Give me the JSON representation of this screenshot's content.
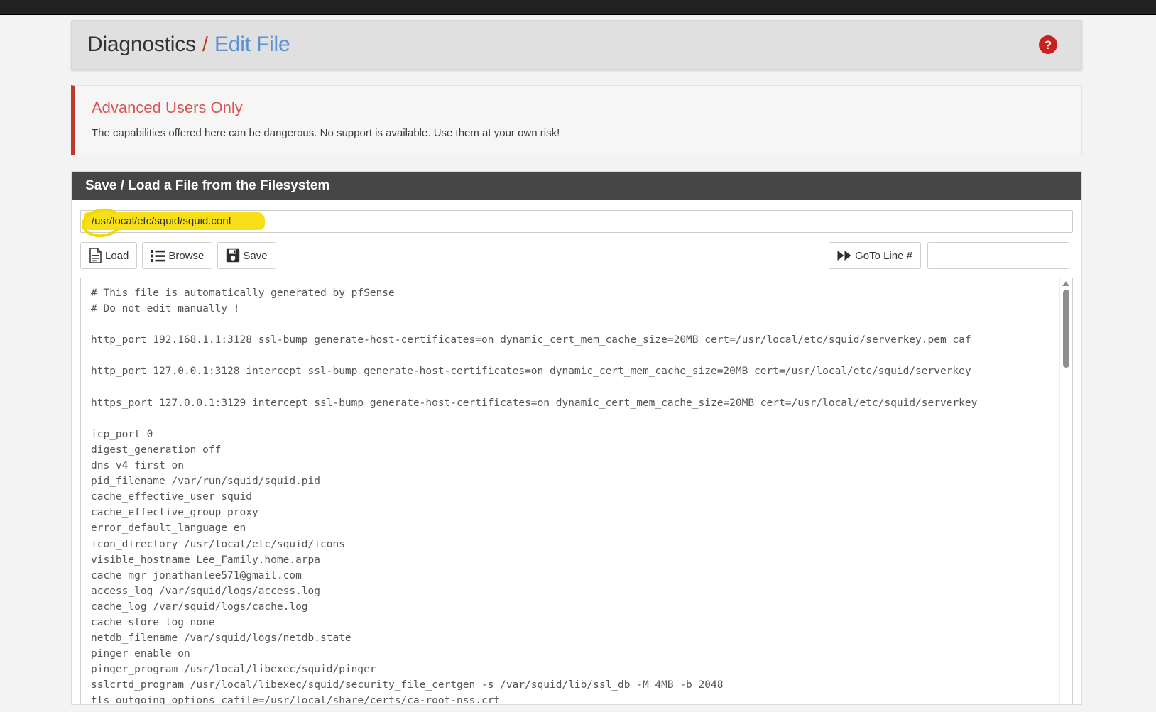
{
  "header": {
    "breadcrumb_parent": "Diagnostics",
    "breadcrumb_separator": "/",
    "breadcrumb_current": "Edit File",
    "help_icon_label": "?"
  },
  "callout": {
    "title": "Advanced Users Only",
    "body": "The capabilities offered here can be dangerous. No support is available. Use them at your own risk!"
  },
  "panel": {
    "heading": "Save / Load a File from the Filesystem"
  },
  "path_field": {
    "value": "/usr/local/etc/squid/squid.conf",
    "placeholder": ""
  },
  "toolbar": {
    "load_label": "Load",
    "browse_label": "Browse",
    "save_label": "Save",
    "goto_label": "GoTo Line #",
    "goto_value": "",
    "goto_placeholder": ""
  },
  "editor": {
    "content": "# This file is automatically generated by pfSense\n# Do not edit manually !\n\nhttp_port 192.168.1.1:3128 ssl-bump generate-host-certificates=on dynamic_cert_mem_cache_size=20MB cert=/usr/local/etc/squid/serverkey.pem caf\n\nhttp_port 127.0.0.1:3128 intercept ssl-bump generate-host-certificates=on dynamic_cert_mem_cache_size=20MB cert=/usr/local/etc/squid/serverkey\n\nhttps_port 127.0.0.1:3129 intercept ssl-bump generate-host-certificates=on dynamic_cert_mem_cache_size=20MB cert=/usr/local/etc/squid/serverkey\n\nicp_port 0\ndigest_generation off\ndns_v4_first on\npid_filename /var/run/squid/squid.pid\ncache_effective_user squid\ncache_effective_group proxy\nerror_default_language en\nicon_directory /usr/local/etc/squid/icons\nvisible_hostname Lee_Family.home.arpa\ncache_mgr jonathanlee571@gmail.com\naccess_log /var/squid/logs/access.log\ncache_log /var/squid/logs/cache.log\ncache_store_log none\nnetdb_filename /var/squid/logs/netdb.state\npinger_enable on\npinger_program /usr/local/libexec/squid/pinger\nsslcrtd_program /usr/local/libexec/squid/security_file_certgen -s /var/squid/lib/ssl_db -M 4MB -b 2048\ntls_outgoing_options cafile=/usr/local/share/certs/ca-root-nss.crt\ntls_outgoing_options capath=/usr/local/share/certs/"
  },
  "colors": {
    "accent_red": "#c0392b",
    "link_blue": "#5b93d3",
    "panel_dark": "#464646",
    "highlight_yellow": "#f7e019",
    "help_red": "#c9221e"
  }
}
